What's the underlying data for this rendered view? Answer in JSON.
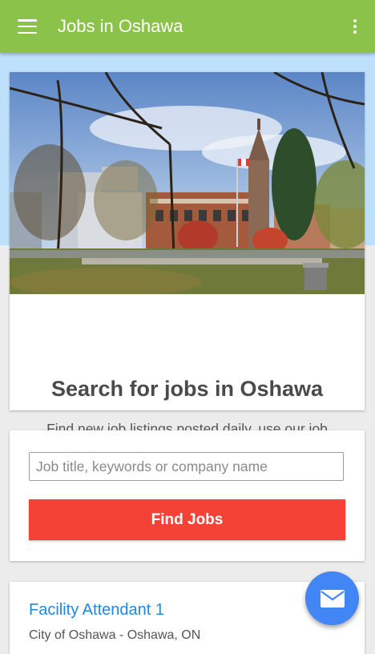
{
  "app": {
    "title": "Jobs in Oshawa"
  },
  "hero": {
    "heading": "Search for jobs in Oshawa",
    "description": "Find new job listings posted daily, use our job search tool to find a job in your local area."
  },
  "search": {
    "placeholder": "Job title, keywords or company name",
    "value": "",
    "button_label": "Find Jobs"
  },
  "jobs": [
    {
      "title": "Facility Attendant 1",
      "company": "City of Oshawa - Oshawa, ON"
    }
  ],
  "colors": {
    "appbar": "#8bc34a",
    "hero_band": "#bfe0fb",
    "find_button": "#f44336",
    "job_title": "#1e88e5",
    "fab": "#4285f4"
  },
  "icons": {
    "menu": "hamburger-menu-icon",
    "overflow": "more-vert-icon",
    "fab": "email-icon"
  }
}
